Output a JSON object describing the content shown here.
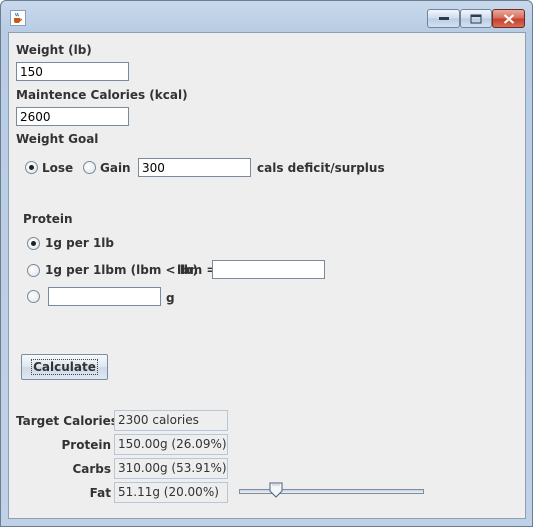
{
  "window": {
    "title": ""
  },
  "form": {
    "weight_label": "Weight (lb)",
    "weight_value": "150",
    "maintenance_label": "Maintence Calories (kcal)",
    "maintenance_value": "2600",
    "goal_label": "Weight Goal",
    "goal_options": {
      "lose": "Lose",
      "gain": "Gain"
    },
    "goal_selected": "lose",
    "goal_amount": "300",
    "goal_suffix": "cals deficit/surplus",
    "protein_label": "Protein",
    "protein_options": {
      "per_lb": "1g per 1lb",
      "per_lbm": "1g per 1lbm (lbm < lb)",
      "lbm_label": "lbm =",
      "lbm_value": "",
      "custom_value": "",
      "custom_unit": "g"
    },
    "protein_selected": "per_lb",
    "calculate_label": "Calculate"
  },
  "results": {
    "target_label": "Target Calories",
    "target_value": "2300 calories",
    "protein_label": "Protein",
    "protein_value": "150.00g (26.09%)",
    "carbs_label": "Carbs",
    "carbs_value": "310.00g (53.91%)",
    "fat_label": "Fat",
    "fat_value": "51.11g (20.00%)",
    "fat_slider_value": 20,
    "fat_slider_min": 0,
    "fat_slider_max": 100
  },
  "icons": {
    "app": "java-cup-icon",
    "minimize": "minimize-icon",
    "maximize": "maximize-icon",
    "close": "close-icon"
  },
  "colors": {
    "client_bg": "#eeeeee",
    "close_button": "#c7412c",
    "title_bar": "#bfd1e6"
  }
}
